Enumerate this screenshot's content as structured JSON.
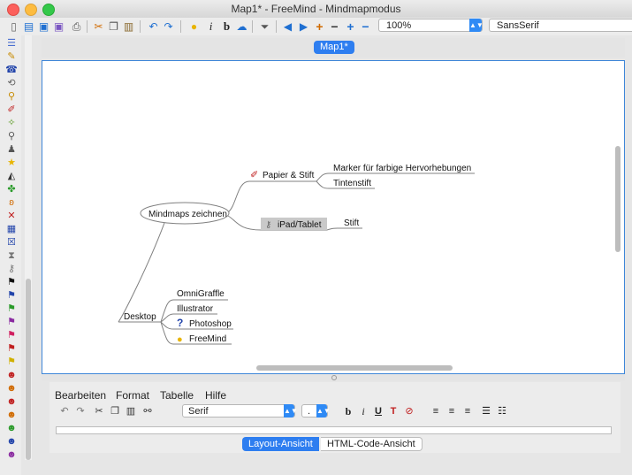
{
  "window": {
    "title": "Map1* - FreeMind - Mindmapmodus"
  },
  "toolbar": {
    "zoom_value": "100%",
    "font_value": "SansSerif",
    "icons": [
      "new-icon",
      "open-icon",
      "save-icon",
      "save-as-icon",
      "print-icon",
      "cut-icon",
      "copy-icon",
      "paste-icon",
      "undo-icon",
      "redo-icon",
      "lightbulb-icon",
      "italic-icon",
      "bold-icon",
      "cloud-icon",
      "filter-icon",
      "nav-back-icon",
      "nav-forward-icon",
      "add-node-icon",
      "remove-node-icon",
      "zoom-in-icon",
      "zoom-out-icon"
    ]
  },
  "map_tab": {
    "label": "Map1*"
  },
  "mindmap": {
    "root": "Mindmaps zeichnen",
    "nodes": {
      "papier": "Papier & Stift",
      "marker": "Marker für farbige Hervorhebungen",
      "tintenstift": "Tintenstift",
      "ipad": "iPad/Tablet",
      "stift": "Stift",
      "desktop": "Desktop",
      "omnigraffle": "OmniGraffle",
      "illustrator": "Illustrator",
      "photoshop": "Photoshop",
      "freemind": "FreeMind"
    }
  },
  "editor": {
    "menu": [
      "Bearbeiten",
      "Format",
      "Tabelle",
      "Hilfe"
    ],
    "font_value": "Serif",
    "size_value": ".",
    "view_tabs": {
      "layout": "Layout-Ansicht",
      "html": "HTML-Code-Ansicht"
    }
  },
  "colors": {
    "accent": "#2e7ef0",
    "frame": "#3e86d8",
    "edge": "#808080"
  }
}
